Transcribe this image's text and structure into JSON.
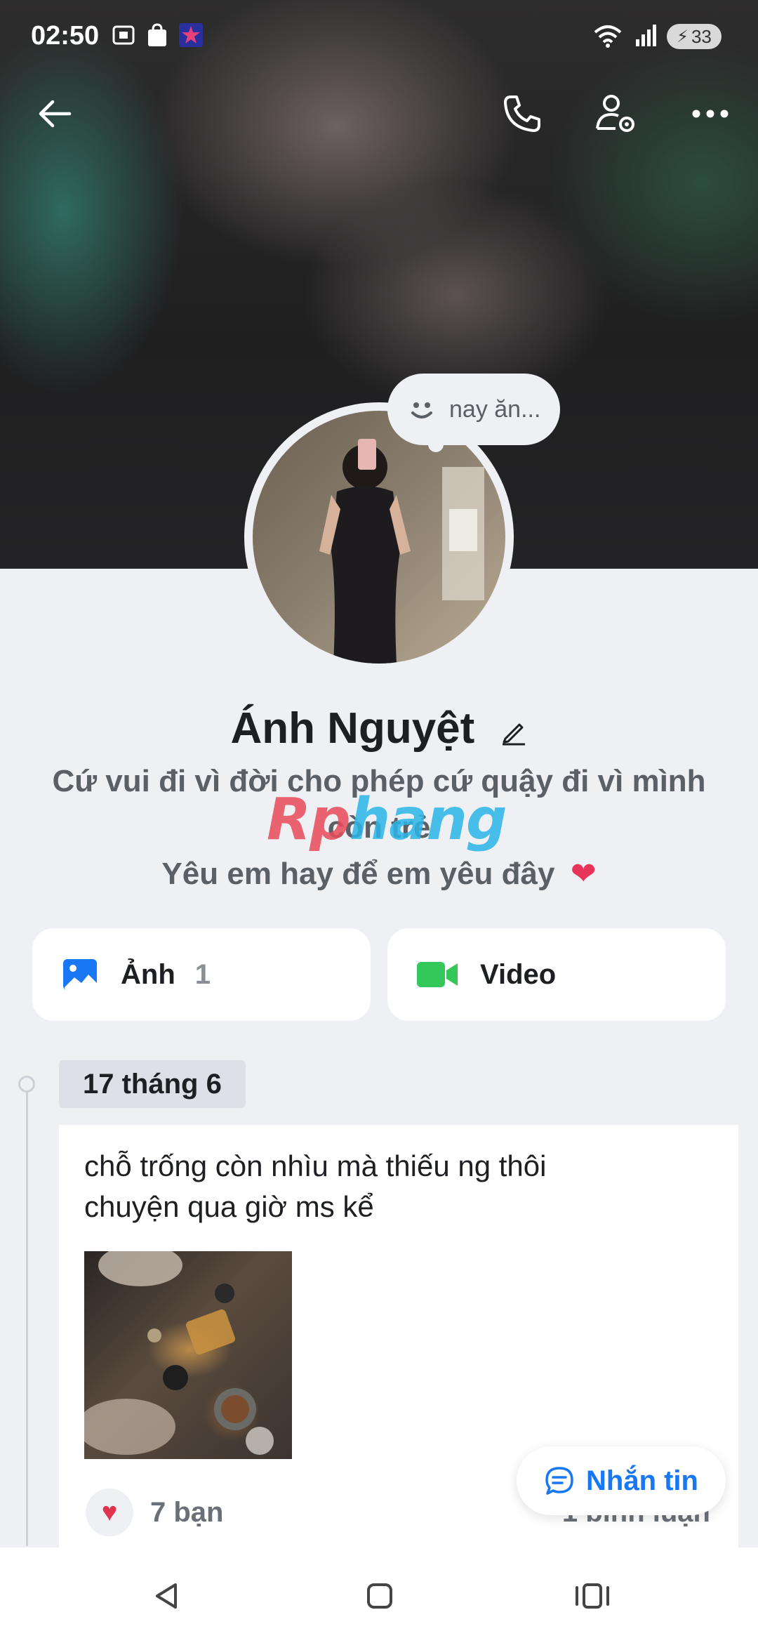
{
  "status_bar": {
    "time": "02:50",
    "battery": "33"
  },
  "top_bar": {
    "back_icon": "arrow-left-icon",
    "call_icon": "phone-icon",
    "settings_icon": "person-gear-icon",
    "more_icon": "more-horizontal-icon"
  },
  "profile": {
    "status_bubble": "nay ăn...",
    "name": "Ánh Nguyệt",
    "bio_line1": "Cứ vui đi vì đời cho phép cứ quậy đi vì mình",
    "bio_line2": "còn trẻ",
    "bio_line3": "Yêu em hay để em yêu đây",
    "bio_emoji": "❤",
    "watermark_part1": "Rp",
    "watermark_part2": "hang"
  },
  "media_buttons": {
    "photos_label": "Ảnh",
    "photos_count": "1",
    "video_label": "Video"
  },
  "timeline": {
    "date": "17 tháng 6",
    "post_text_line1": "chỗ trống còn nhìu mà thiếu ng thôi",
    "post_text_line2": "chuyện qua giờ ms kể",
    "reaction_count": "7 bạn",
    "comment_count": "1 bình luận"
  },
  "message_button": {
    "label": "Nhắn tin"
  },
  "colors": {
    "accent": "#1877f2",
    "video_green": "#34c759",
    "background": "#eef0f4"
  }
}
